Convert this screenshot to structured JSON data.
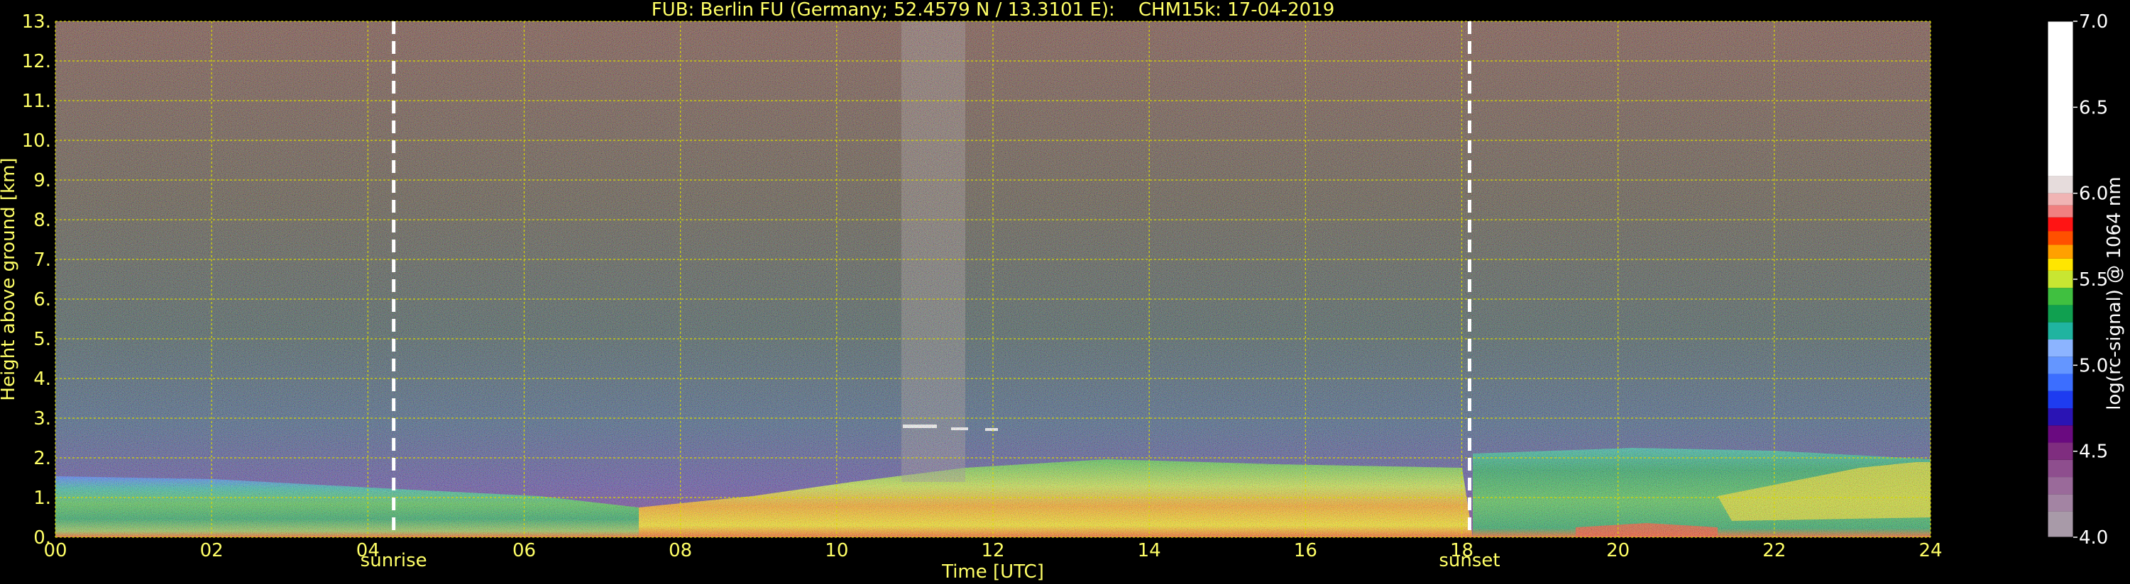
{
  "colors": {
    "background": "#000000",
    "text": "#ffff66",
    "colorbar_text": "#ffffff",
    "grid": "#d8d800",
    "marker_line": "#ffffff"
  },
  "chart_data": {
    "type": "heatmap",
    "title": "FUB: Berlin FU (Germany; 52.4579 N / 13.3101 E):    CHM15k: 17-04-2019",
    "xlabel": "Time [UTC]",
    "ylabel": "Height above ground [km]",
    "xlim": [
      0,
      24
    ],
    "ylim": [
      0,
      13
    ],
    "x_ticks": [
      {
        "value": 0,
        "label": "00"
      },
      {
        "value": 2,
        "label": "02"
      },
      {
        "value": 4,
        "label": "04"
      },
      {
        "value": 6,
        "label": "06"
      },
      {
        "value": 8,
        "label": "08"
      },
      {
        "value": 10,
        "label": "10"
      },
      {
        "value": 12,
        "label": "12"
      },
      {
        "value": 14,
        "label": "14"
      },
      {
        "value": 16,
        "label": "16"
      },
      {
        "value": 18,
        "label": "18"
      },
      {
        "value": 20,
        "label": "20"
      },
      {
        "value": 22,
        "label": "22"
      },
      {
        "value": 24,
        "label": "24"
      }
    ],
    "y_ticks": [
      {
        "value": 0,
        "label": "0."
      },
      {
        "value": 1,
        "label": "1."
      },
      {
        "value": 2,
        "label": "2."
      },
      {
        "value": 3,
        "label": "3."
      },
      {
        "value": 4,
        "label": "4."
      },
      {
        "value": 5,
        "label": "5."
      },
      {
        "value": 6,
        "label": "6."
      },
      {
        "value": 7,
        "label": "7."
      },
      {
        "value": 8,
        "label": "8."
      },
      {
        "value": 9,
        "label": "9."
      },
      {
        "value": 10,
        "label": "10."
      },
      {
        "value": 11,
        "label": "11."
      },
      {
        "value": 12,
        "label": "12."
      },
      {
        "value": 13,
        "label": "13."
      }
    ],
    "grid": true,
    "markers": [
      {
        "x": 4.33,
        "label": "sunrise"
      },
      {
        "x": 18.1,
        "label": "sunset"
      }
    ],
    "colorbar": {
      "label": "log(rc-signal) @ 1064 nm",
      "range": [
        4.0,
        7.0
      ],
      "ticks": [
        {
          "value": 4.0,
          "label": "4.0"
        },
        {
          "value": 4.5,
          "label": "4.5"
        },
        {
          "value": 5.0,
          "label": "5.0"
        },
        {
          "value": 5.5,
          "label": "5.5"
        },
        {
          "value": 6.0,
          "label": "6.0"
        },
        {
          "value": 6.5,
          "label": "6.5"
        },
        {
          "value": 7.0,
          "label": "7.0"
        }
      ],
      "bands": [
        {
          "from": 4.0,
          "to": 4.15,
          "color": "#a89aa8"
        },
        {
          "from": 4.15,
          "to": 4.25,
          "color": "#a384a3"
        },
        {
          "from": 4.25,
          "to": 4.35,
          "color": "#9a6a9a"
        },
        {
          "from": 4.35,
          "to": 4.45,
          "color": "#8e4e8e"
        },
        {
          "from": 4.45,
          "to": 4.55,
          "color": "#7f2d7f"
        },
        {
          "from": 4.55,
          "to": 4.65,
          "color": "#6a0a80"
        },
        {
          "from": 4.65,
          "to": 4.75,
          "color": "#2a14b4"
        },
        {
          "from": 4.75,
          "to": 4.85,
          "color": "#1e3cf0"
        },
        {
          "from": 4.85,
          "to": 4.95,
          "color": "#3c6eff"
        },
        {
          "from": 4.95,
          "to": 5.05,
          "color": "#6496ff"
        },
        {
          "from": 5.05,
          "to": 5.15,
          "color": "#8cb4ff"
        },
        {
          "from": 5.15,
          "to": 5.25,
          "color": "#20b4a0"
        },
        {
          "from": 5.25,
          "to": 5.35,
          "color": "#10a050"
        },
        {
          "from": 5.35,
          "to": 5.45,
          "color": "#40c040"
        },
        {
          "from": 5.45,
          "to": 5.55,
          "color": "#c8e632"
        },
        {
          "from": 5.55,
          "to": 5.62,
          "color": "#ffe600"
        },
        {
          "from": 5.62,
          "to": 5.7,
          "color": "#ffa000"
        },
        {
          "from": 5.7,
          "to": 5.78,
          "color": "#ff5000"
        },
        {
          "from": 5.78,
          "to": 5.86,
          "color": "#ff1414"
        },
        {
          "from": 5.86,
          "to": 5.93,
          "color": "#f08080"
        },
        {
          "from": 5.93,
          "to": 6.0,
          "color": "#f0b4b4"
        },
        {
          "from": 6.0,
          "to": 6.1,
          "color": "#e6dcdc"
        },
        {
          "from": 6.1,
          "to": 7.0,
          "color": "#ffffff"
        }
      ]
    }
  }
}
